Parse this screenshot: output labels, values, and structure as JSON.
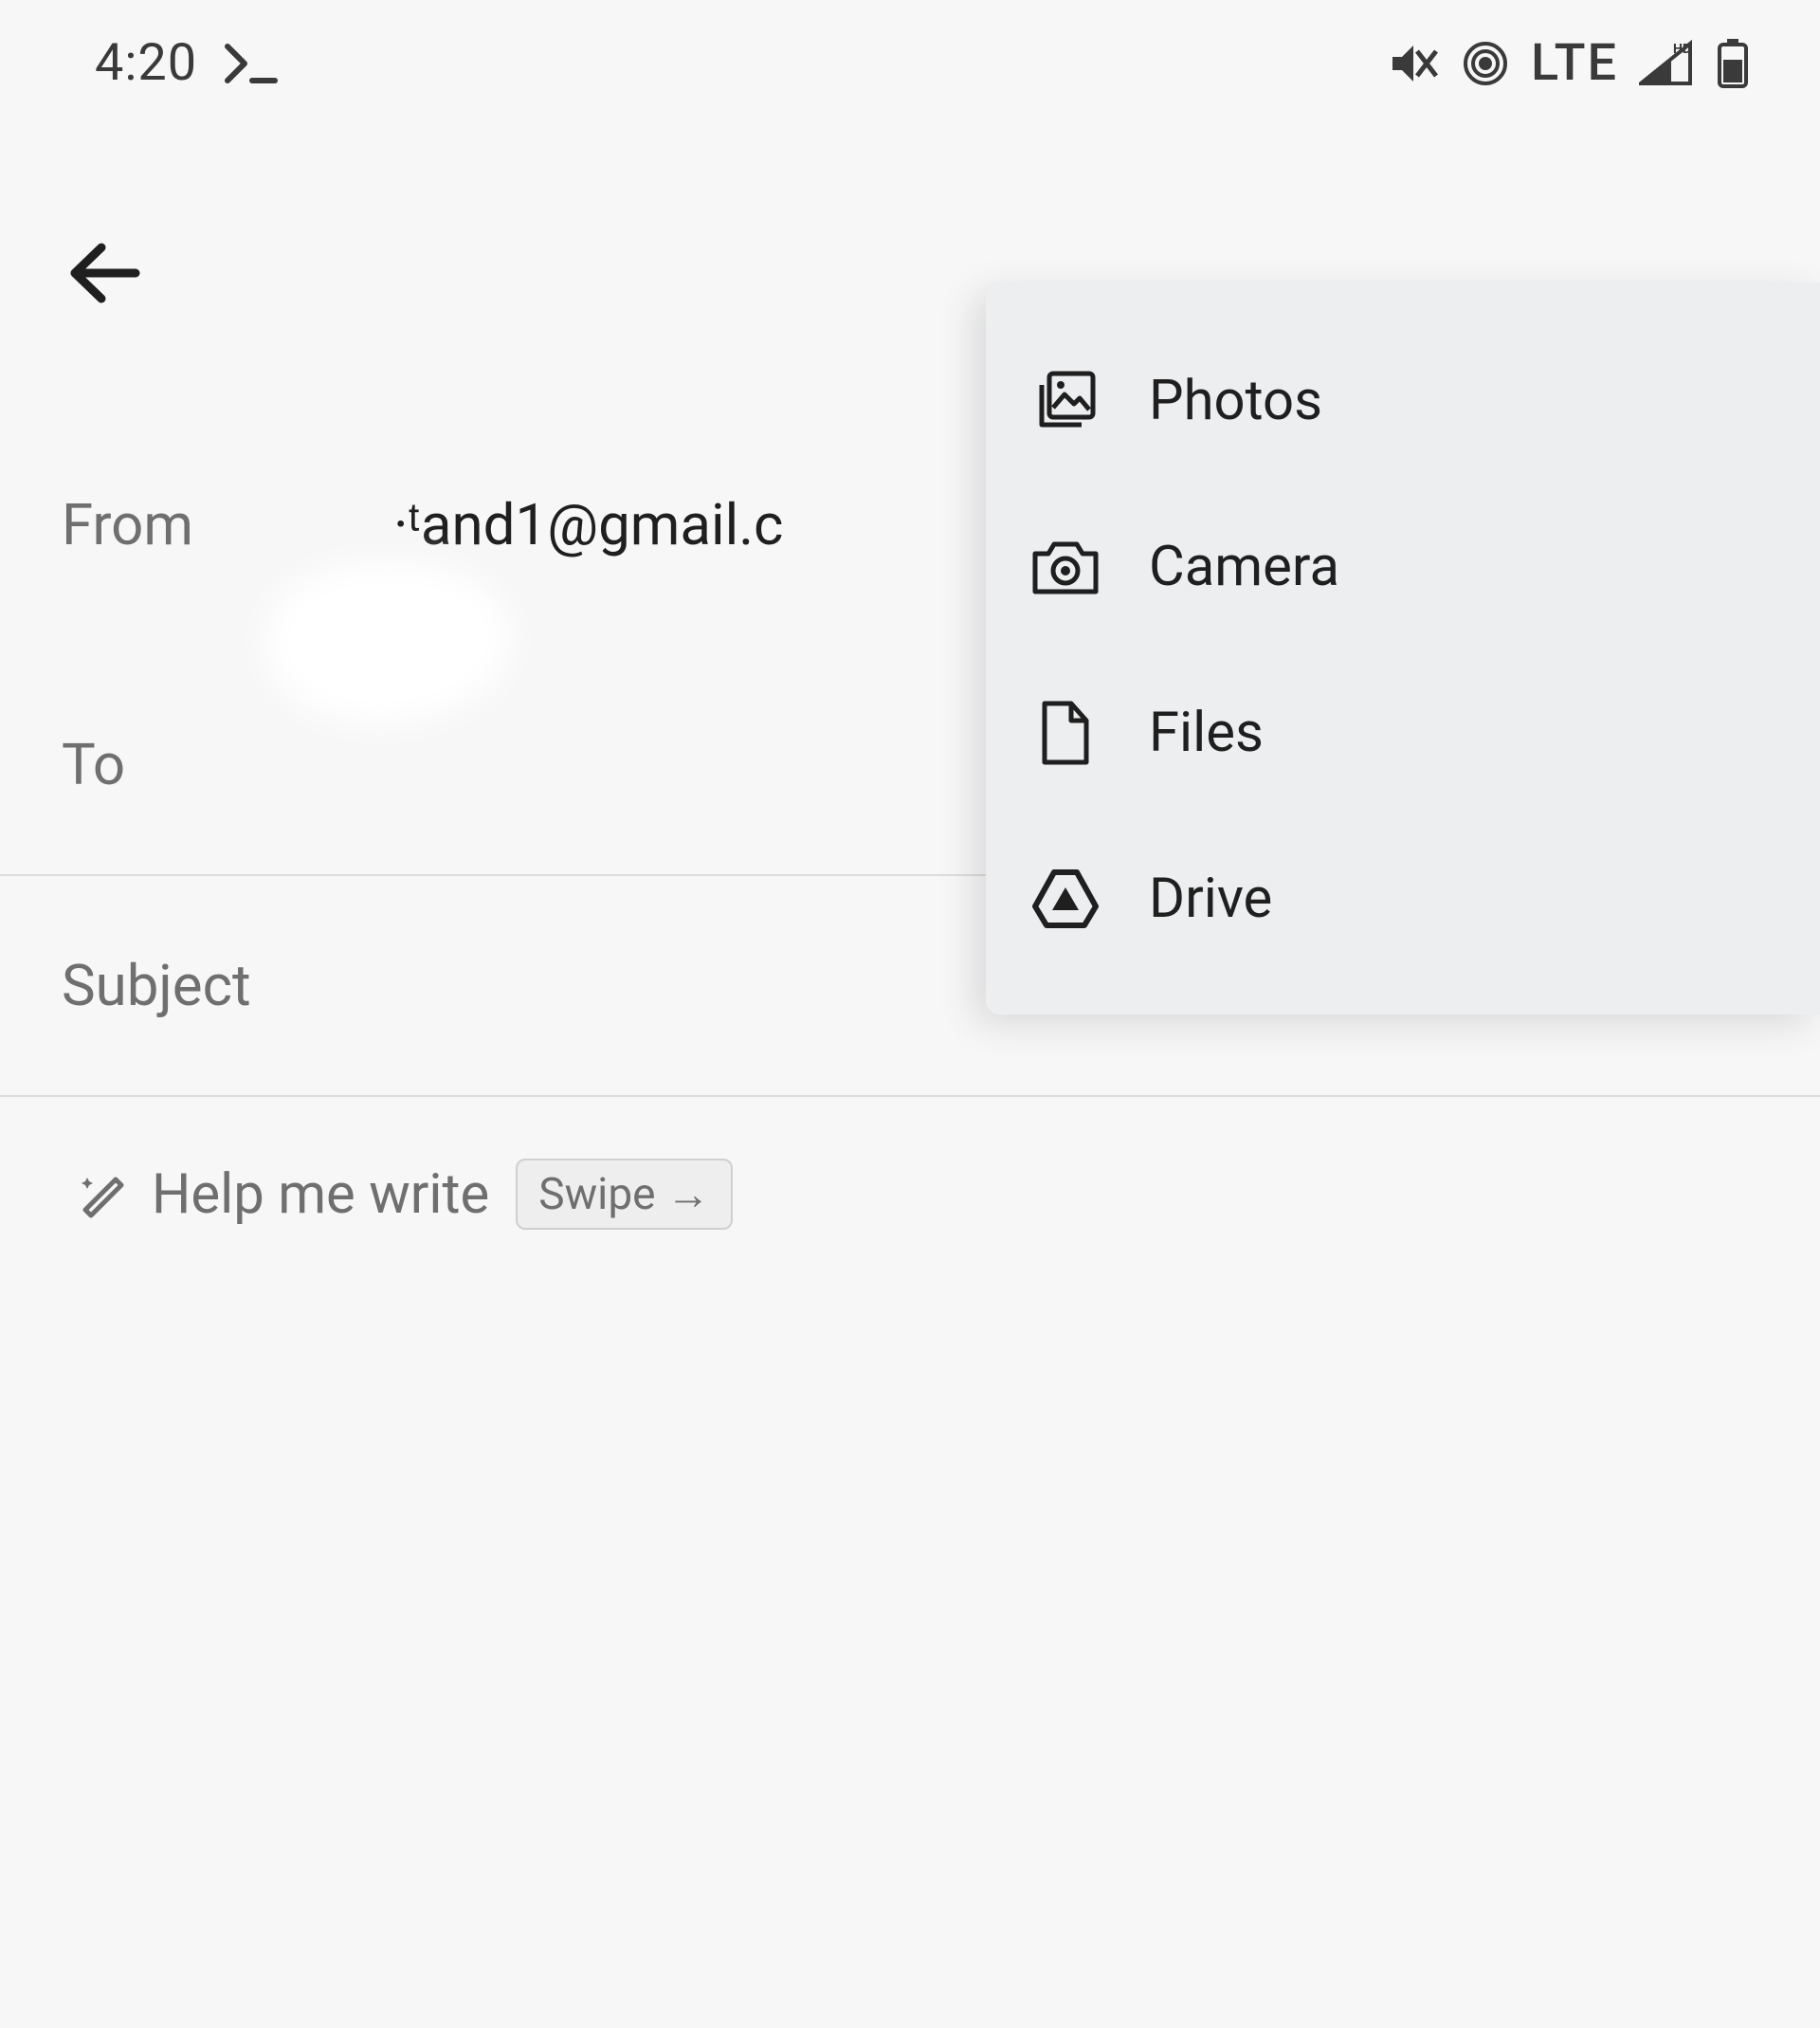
{
  "status": {
    "time": "4:20",
    "network_label": "LTE"
  },
  "compose": {
    "from_label": "From",
    "from_value": "·ᵗand1@gmail.c",
    "to_label": "To",
    "to_value": "",
    "subject_placeholder": "Subject",
    "help_label": "Help me write",
    "swipe_hint": "Swipe →"
  },
  "attach_menu": {
    "items": [
      {
        "label": "Photos"
      },
      {
        "label": "Camera"
      },
      {
        "label": "Files"
      },
      {
        "label": "Drive"
      }
    ]
  }
}
